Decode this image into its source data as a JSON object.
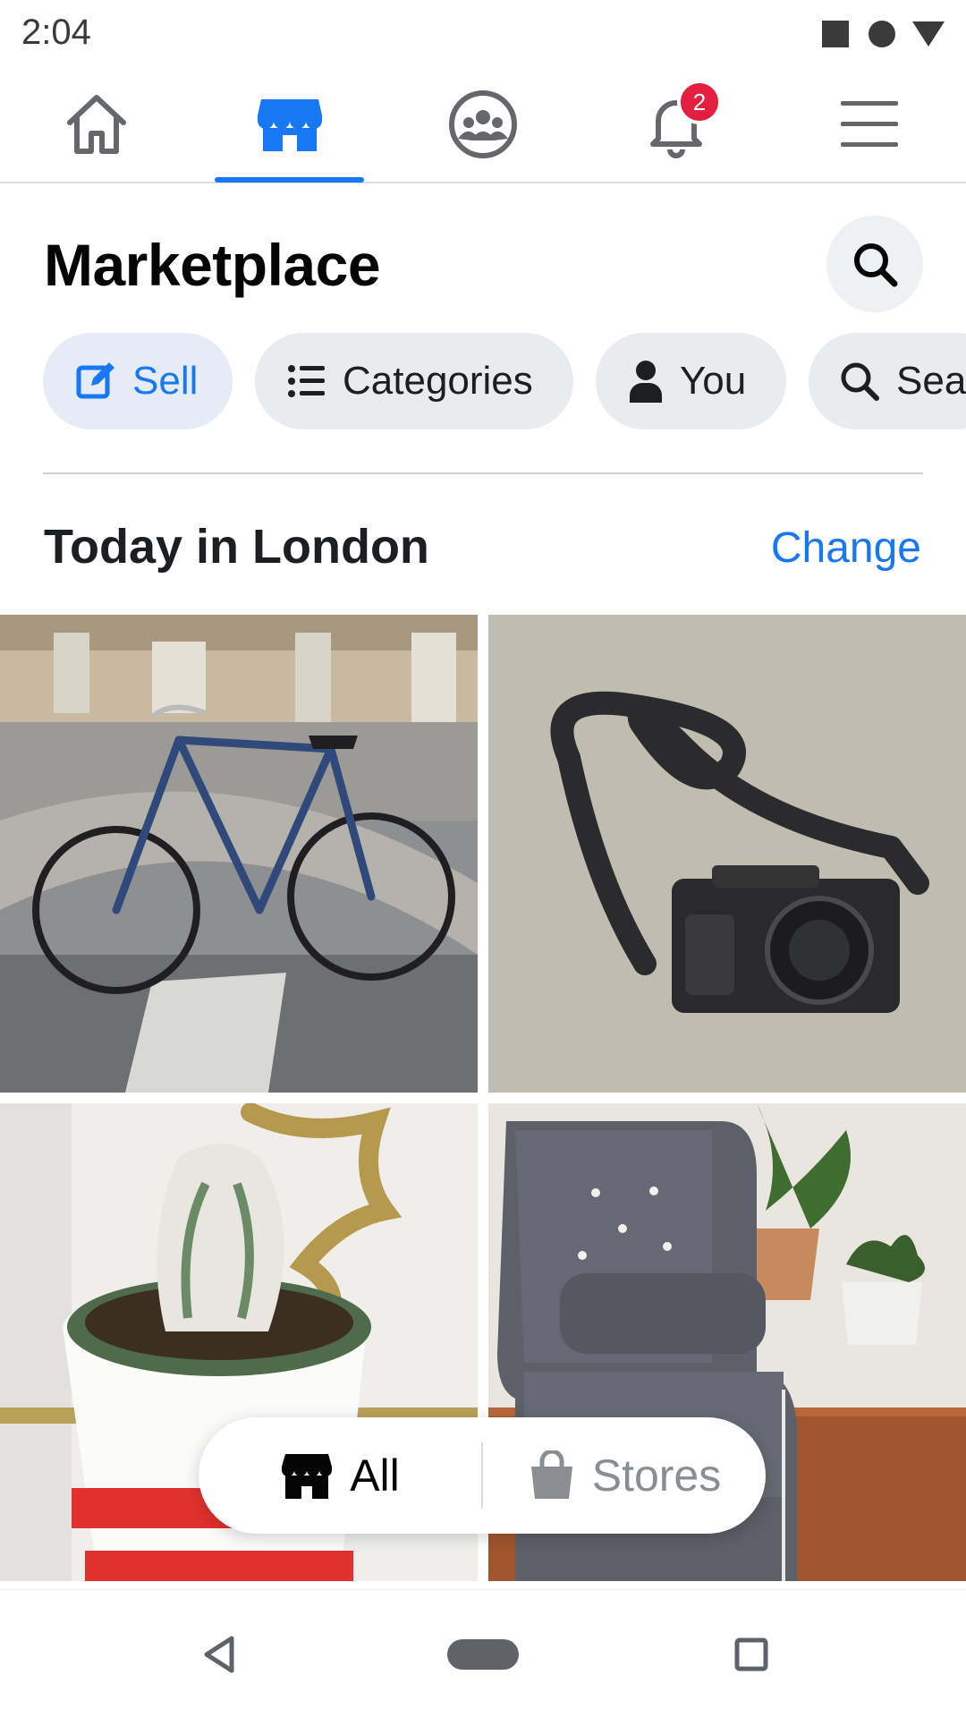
{
  "status_bar": {
    "time": "2:04",
    "icons": [
      "stop-square-icon",
      "record-dot-icon",
      "signal-triangle-icon"
    ]
  },
  "top_nav": {
    "items": [
      {
        "name": "home",
        "icon": "home-icon",
        "active": false
      },
      {
        "name": "marketplace",
        "icon": "store-icon",
        "active": true
      },
      {
        "name": "groups",
        "icon": "groups-icon",
        "active": false
      },
      {
        "name": "notifications",
        "icon": "bell-icon",
        "active": false,
        "badge": "2"
      },
      {
        "name": "menu",
        "icon": "hamburger-menu-icon",
        "active": false
      }
    ]
  },
  "header": {
    "title": "Marketplace",
    "search_icon": "search-icon"
  },
  "chips": [
    {
      "label": "Sell",
      "icon": "edit-square-icon"
    },
    {
      "label": "Categories",
      "icon": "list-icon"
    },
    {
      "label": "You",
      "icon": "person-icon"
    },
    {
      "label": "Sea",
      "icon": "search-icon"
    }
  ],
  "section": {
    "title": "Today in London",
    "action": "Change"
  },
  "listings": [
    {
      "subject": "bicycle-photo"
    },
    {
      "subject": "camera-photo"
    },
    {
      "subject": "cactus-photo"
    },
    {
      "subject": "armchair-photo"
    }
  ],
  "toggle": {
    "all_label": "All",
    "stores_label": "Stores",
    "selected": "All"
  },
  "system_nav": [
    "back-icon",
    "home-pill-icon",
    "recents-icon"
  ],
  "colors": {
    "accent": "#1877f2",
    "badge": "#e41e3f",
    "chip_bg": "#e9ebee",
    "text": "#050505",
    "muted": "#8a8d91"
  }
}
